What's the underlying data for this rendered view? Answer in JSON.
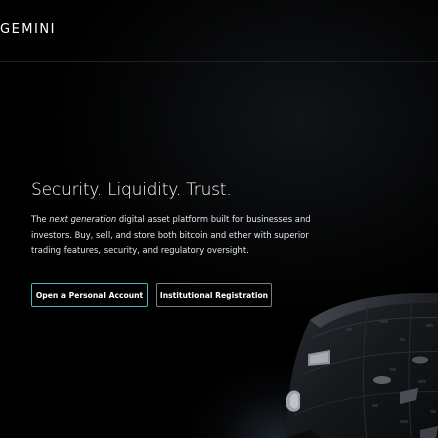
{
  "header": {
    "logo_text": "GEMINI"
  },
  "hero": {
    "headline": "Security. Liquidity. Trust.",
    "description_prefix": "The ",
    "description_emphasis": "next generation",
    "description_rest": " digital asset platform built for businesses and investors. Buy, sell, and store both bitcoin and ether with superior trading features, security, and regulatory oversight."
  },
  "buttons": {
    "personal_label": "Open a Personal Account",
    "institutional_label": "Institutional Registration"
  },
  "colors": {
    "background": "#000000",
    "accent_border": "#3fb8c9",
    "secondary_border": "#7b7e84",
    "text": "#ffffff"
  }
}
